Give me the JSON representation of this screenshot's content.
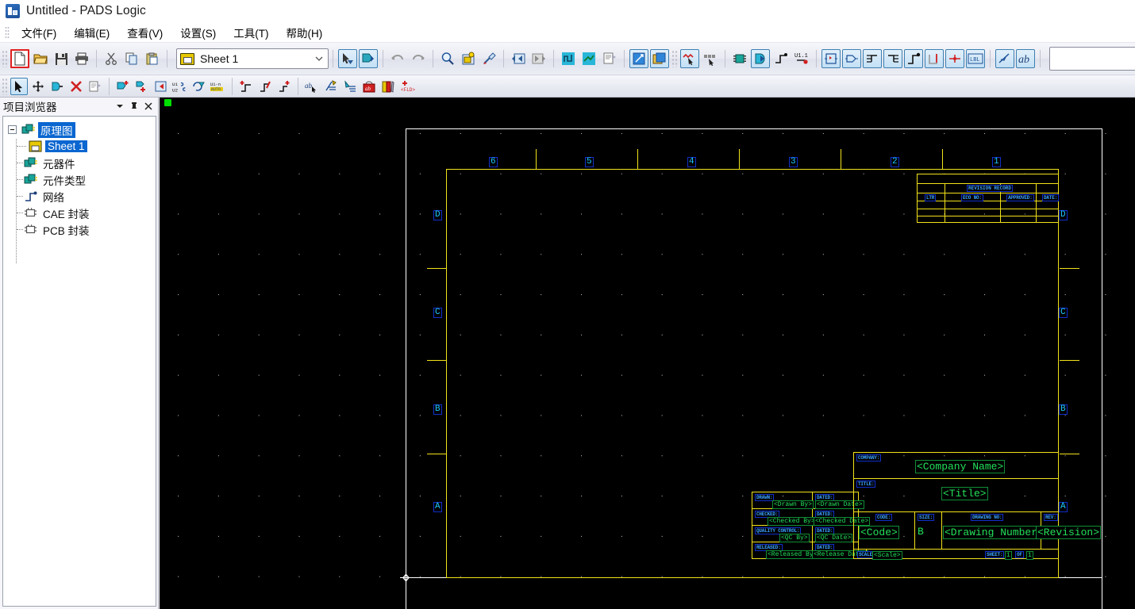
{
  "window": {
    "title": "Untitled - PADS Logic",
    "app_icon": "pads-logic-icon"
  },
  "menubar": {
    "items": [
      {
        "label": "文件(F)",
        "accel": "F"
      },
      {
        "label": "编辑(E)",
        "accel": "E"
      },
      {
        "label": "查看(V)",
        "accel": "V"
      },
      {
        "label": "设置(S)",
        "accel": "S"
      },
      {
        "label": "工具(T)",
        "accel": "T"
      },
      {
        "label": "帮助(H)",
        "accel": "H"
      }
    ]
  },
  "toolbar_main": {
    "sheet_selector": {
      "value": "Sheet 1",
      "icon": "sheet-icon"
    },
    "find_field": {
      "value": "",
      "placeholder": ""
    },
    "buttons": [
      {
        "name": "new-file-button",
        "icon": "new-document-icon",
        "state": "highlighted"
      },
      {
        "name": "open-file-button",
        "icon": "open-folder-icon",
        "state": "normal"
      },
      {
        "name": "save-file-button",
        "icon": "floppy-save-icon",
        "state": "normal"
      },
      {
        "name": "print-button",
        "icon": "printer-icon",
        "state": "normal"
      },
      {
        "name": "cut-button",
        "icon": "scissors-icon",
        "state": "normal"
      },
      {
        "name": "copy-button",
        "icon": "copy-icon",
        "state": "normal"
      },
      {
        "name": "paste-button",
        "icon": "clipboard-paste-icon",
        "state": "normal"
      },
      {
        "name": "select-arrow-button",
        "icon": "arrow-select-icon",
        "state": "selected"
      },
      {
        "name": "select-component-button",
        "icon": "select-component-icon",
        "state": "selected"
      },
      {
        "name": "undo-button",
        "icon": "undo-arrow-icon",
        "state": "disabled"
      },
      {
        "name": "redo-button",
        "icon": "redo-arrow-icon",
        "state": "disabled"
      },
      {
        "name": "zoom-button",
        "icon": "magnifier-icon",
        "state": "normal"
      },
      {
        "name": "sheet-view-button",
        "icon": "sheet-zoom-icon",
        "state": "normal"
      },
      {
        "name": "refresh-button",
        "icon": "broom-refresh-icon",
        "state": "normal"
      },
      {
        "name": "previous-sheet-button",
        "icon": "left-sheet-arrow-icon",
        "state": "normal"
      },
      {
        "name": "next-sheet-button",
        "icon": "right-sheet-arrow-icon",
        "state": "disabled"
      },
      {
        "name": "net-list-button",
        "icon": "blue-net-icon",
        "state": "normal"
      },
      {
        "name": "net-bus-button",
        "icon": "blue-bus-icon",
        "state": "normal"
      },
      {
        "name": "report-button",
        "icon": "report-icon",
        "state": "normal"
      },
      {
        "name": "pcb-link-button",
        "icon": "pcb-link-icon",
        "state": "selected"
      },
      {
        "name": "library-button",
        "icon": "library-icon",
        "state": "selected"
      },
      {
        "name": "select-net-button",
        "icon": "select-net-icon",
        "state": "selected"
      },
      {
        "name": "select-pins-button",
        "icon": "select-pins-icon",
        "state": "normal"
      },
      {
        "name": "add-part-button",
        "icon": "chip-icon",
        "state": "normal"
      },
      {
        "name": "add-gate-button",
        "icon": "gate-icon",
        "state": "selected"
      },
      {
        "name": "add-connection-button",
        "icon": "connection-icon",
        "state": "normal"
      },
      {
        "name": "rename-ref-button",
        "icon": "u11-ref-icon",
        "state": "normal"
      },
      {
        "name": "add-hierarchy-button",
        "icon": "hierarchy-block-icon",
        "state": "selected"
      },
      {
        "name": "add-symbol-button",
        "icon": "symbol-icon",
        "state": "selected"
      },
      {
        "name": "add-net-label-button",
        "icon": "net-label-icon",
        "state": "selected"
      },
      {
        "name": "add-bus-button",
        "icon": "bus-icon",
        "state": "selected"
      },
      {
        "name": "add-wire-button",
        "icon": "wire-icon",
        "state": "selected"
      },
      {
        "name": "add-offpage-button",
        "icon": "offpage-icon",
        "state": "selected"
      },
      {
        "name": "add-junction-button",
        "icon": "junction-icon",
        "state": "selected"
      },
      {
        "name": "add-label-button",
        "icon": "lbl-icon",
        "state": "selected"
      },
      {
        "name": "draw-line-button",
        "icon": "draw-line-icon",
        "state": "selected"
      },
      {
        "name": "add-text-button",
        "icon": "text-ab-icon",
        "state": "selected"
      },
      {
        "name": "nav-up-button",
        "icon": "up-arrow-icon",
        "state": "normal"
      },
      {
        "name": "nav-down-button",
        "icon": "down-arrow-icon",
        "state": "normal"
      }
    ]
  },
  "toolbar_secondary": {
    "buttons": [
      {
        "name": "select-tool-button",
        "icon": "cursor-arrow-icon",
        "state": "selected"
      },
      {
        "name": "move-tool-button",
        "icon": "move-cross-icon",
        "state": "normal"
      },
      {
        "name": "gate-swap-button",
        "icon": "gate-minus-icon",
        "state": "normal"
      },
      {
        "name": "delete-button",
        "icon": "red-x-icon",
        "state": "normal"
      },
      {
        "name": "properties-button",
        "icon": "properties-icon",
        "state": "normal"
      },
      {
        "name": "add-part-plus-button",
        "icon": "part-plus-icon",
        "state": "normal"
      },
      {
        "name": "add-gate-plus-button",
        "icon": "gate-plus-icon",
        "state": "normal"
      },
      {
        "name": "add-sheet-button",
        "icon": "sheet-arrow-icon",
        "state": "normal"
      },
      {
        "name": "swap-refdes-button",
        "icon": "u1-u2-swap-icon",
        "state": "normal"
      },
      {
        "name": "renumber-button",
        "icon": "renumber-icon",
        "state": "normal"
      },
      {
        "name": "auto-rename-button",
        "icon": "u1n-auto-icon",
        "state": "normal"
      },
      {
        "name": "add-pin-button",
        "icon": "pin-plus-icon",
        "state": "normal"
      },
      {
        "name": "edit-pin-button",
        "icon": "pin-edit-icon",
        "state": "normal"
      },
      {
        "name": "new-pin-button",
        "icon": "pin-new-icon",
        "state": "normal"
      },
      {
        "name": "edit-text-button",
        "icon": "ab-cursor-icon",
        "state": "normal"
      },
      {
        "name": "text-style-button",
        "icon": "text-style-icon",
        "state": "normal"
      },
      {
        "name": "text-align-button",
        "icon": "text-align-icon",
        "state": "normal"
      },
      {
        "name": "text-attr-button",
        "icon": "ab-bag-icon",
        "state": "normal"
      },
      {
        "name": "field-book-button",
        "icon": "field-book-icon",
        "state": "normal"
      },
      {
        "name": "add-field-button",
        "icon": "fld-plus-icon",
        "state": "normal"
      }
    ]
  },
  "browser": {
    "title": "项目浏览器",
    "header_buttons": [
      {
        "name": "browser-menu-button",
        "icon": "chevron-down-icon"
      },
      {
        "name": "browser-pin-button",
        "icon": "pin-icon"
      },
      {
        "name": "browser-close-button",
        "icon": "close-icon"
      }
    ],
    "tree": [
      {
        "label": "原理图",
        "icon": "schematic-icon",
        "selected": true,
        "level": 0,
        "expander": true
      },
      {
        "label": "Sheet 1",
        "icon": "sheet-icon",
        "selected": true,
        "level": 1,
        "expander": false
      },
      {
        "label": "元器件",
        "icon": "components-icon",
        "selected": false,
        "level": 0,
        "expander": false
      },
      {
        "label": "元件类型",
        "icon": "parttypes-icon",
        "selected": false,
        "level": 0,
        "expander": false
      },
      {
        "label": "网络",
        "icon": "nets-icon",
        "selected": false,
        "level": 0,
        "expander": false
      },
      {
        "label": "CAE 封装",
        "icon": "cae-decal-icon",
        "selected": false,
        "level": 0,
        "expander": false
      },
      {
        "label": "PCB 封装",
        "icon": "pcb-decal-icon",
        "selected": false,
        "level": 0,
        "expander": false
      }
    ]
  },
  "canvas": {
    "background_color": "#000000",
    "grid_color": "#cfcfcf",
    "frame_color": "#f2e21a",
    "label_blue": "#3aa0ff",
    "label_green": "#22e05a",
    "sheet_border_color": "#ffffff",
    "origin_marker": "origin-crosshair-icon",
    "zones_top": [
      "6",
      "5",
      "4",
      "3",
      "2",
      "1"
    ],
    "zones_left": [
      "D",
      "C",
      "B",
      "A"
    ],
    "zones_right": [
      "D",
      "C",
      "B",
      "A"
    ],
    "revision_record": {
      "title": "REVISION RECORD",
      "columns": [
        "LTR",
        "ECO NO:",
        "APPROVED:",
        "DATE:"
      ],
      "rows": [
        [
          "",
          "",
          "",
          ""
        ],
        [
          "",
          "",
          "",
          ""
        ],
        [
          "",
          "",
          "",
          ""
        ],
        [
          "",
          "",
          "",
          ""
        ]
      ]
    },
    "signoff_block": [
      {
        "label": "DRAWN:",
        "value": "<Drawn By>",
        "date_label": "DATED:",
        "date_value": "<Drawn Date>"
      },
      {
        "label": "CHECKED:",
        "value": "<Checked By>",
        "date_label": "DATED:",
        "date_value": "<Checked Date>"
      },
      {
        "label": "QUALITY CONTROL:",
        "value": "<QC By>",
        "date_label": "DATED:",
        "date_value": "<QC Date>"
      },
      {
        "label": "RELEASED:",
        "value": "<Released By>",
        "date_label": "DATED:",
        "date_value": "<Release Date>"
      }
    ],
    "title_block": {
      "company_label": "COMPANY:",
      "company_value": "<Company Name>",
      "title_label": "TITLE:",
      "title_value": "<Title>",
      "code_label": "CODE:",
      "code_value": "<Code>",
      "size_label": "SIZE:",
      "size_value": "B",
      "drawing_no_label": "DRAWING NO:",
      "drawing_no_value": "<Drawing Number>",
      "rev_label": "REV:",
      "rev_value": "<Revision>",
      "scale_label": "SCALE:",
      "scale_value": "<Scale>",
      "sheet_label": "SHEET:",
      "sheet_number": "1",
      "sheet_of_label": "OF",
      "sheet_total": "1"
    }
  }
}
